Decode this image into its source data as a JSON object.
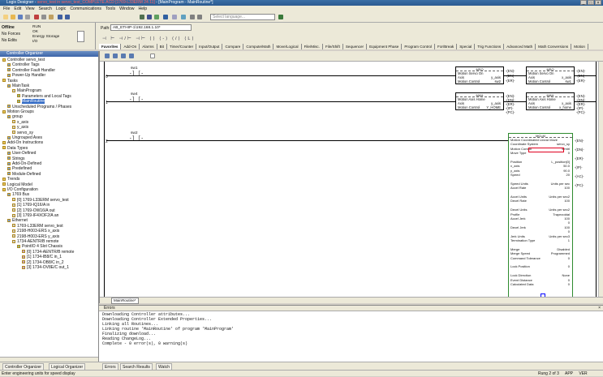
{
  "window": {
    "title_prefix": "Logix Designer - ",
    "title_red": "servo_test in servo_test_COMPLETE.ACD [1769-L33ERM 24.11]",
    "title_suffix": " - [MainProgram - MainRoutine*]"
  },
  "menu": [
    "File",
    "Edit",
    "View",
    "Search",
    "Logic",
    "Communications",
    "Tools",
    "Window",
    "Help"
  ],
  "toolbar": {
    "language_placeholder": "Select language..."
  },
  "controller_status": {
    "mode": "Offline",
    "forces": "No Forces",
    "edits": "No Edits",
    "run_label": "RUN",
    "ok_label": "OK",
    "energy_label": "Energy Storage",
    "io_label": "I/O",
    "path_label": "Path:",
    "path_value": "AB_ETHIP-1\\192.168.1.10*"
  },
  "instruction_tabs": [
    "Favorites",
    "Add-On",
    "Alarms",
    "Bit",
    "Timer/Counter",
    "Input/Output",
    "Compare",
    "Compute/Math",
    "Move/Logical",
    "File/Misc.",
    "File/Shift",
    "Sequencer",
    "Equipment Phase",
    "Program Control",
    "For/Break",
    "Special",
    "Trig Functions",
    "Advanced Math",
    "Math Conversions",
    "Motion"
  ],
  "organizer": {
    "title": "Controller Organizer",
    "tree": [
      {
        "label": "Controller servo_test",
        "indent": 0
      },
      {
        "label": "Controller Tags",
        "indent": 1
      },
      {
        "label": "Controller Fault Handler",
        "indent": 1
      },
      {
        "label": "Power-Up Handler",
        "indent": 1
      },
      {
        "label": "Tasks",
        "indent": 0
      },
      {
        "label": "MainTask",
        "indent": 1
      },
      {
        "label": "MainProgram",
        "indent": 2
      },
      {
        "label": "Parameters and Local Tags",
        "indent": 3
      },
      {
        "label": "MainRoutine",
        "indent": 3,
        "selected": true
      },
      {
        "label": "Unscheduled Programs / Phases",
        "indent": 1
      },
      {
        "label": "Motion Groups",
        "indent": 0
      },
      {
        "label": "group",
        "indent": 1
      },
      {
        "label": "x_axis",
        "indent": 2
      },
      {
        "label": "y_axis",
        "indent": 2
      },
      {
        "label": "servo_sy",
        "indent": 2
      },
      {
        "label": "Ungrouped Axes",
        "indent": 1
      },
      {
        "label": "Add-On Instructions",
        "indent": 0
      },
      {
        "label": "Data Types",
        "indent": 0
      },
      {
        "label": "User-Defined",
        "indent": 1
      },
      {
        "label": "Strings",
        "indent": 1
      },
      {
        "label": "Add-On-Defined",
        "indent": 1
      },
      {
        "label": "Predefined",
        "indent": 1
      },
      {
        "label": "Module-Defined",
        "indent": 1
      },
      {
        "label": "Trends",
        "indent": 0
      },
      {
        "label": "Logical Model",
        "indent": 0
      },
      {
        "label": "I/O Configuration",
        "indent": 0
      },
      {
        "label": "1769 Bus",
        "indent": 1
      },
      {
        "label": "[0] 1769-L33ERM servo_test",
        "indent": 2
      },
      {
        "label": "[1] 1769-IQ16/A in",
        "indent": 2
      },
      {
        "label": "[2] 1769-OW16/A out",
        "indent": 2
      },
      {
        "label": "[3] 1769-IF4XOF2/A an",
        "indent": 2
      },
      {
        "label": "Ethernet",
        "indent": 1
      },
      {
        "label": "1769-L33ERM servo_test",
        "indent": 2
      },
      {
        "label": "2198-H003-ERS x_axis",
        "indent": 2
      },
      {
        "label": "2198-H003-ERS y_axis",
        "indent": 2
      },
      {
        "label": "1734-AENTR/B remote",
        "indent": 2
      },
      {
        "label": "PointIO 4 Slot Chassis",
        "indent": 3
      },
      {
        "label": "[0] 1734-AENTR/B remote",
        "indent": 4
      },
      {
        "label": "[1] 1734-IB8/C in_1",
        "indent": 4
      },
      {
        "label": "[2] 1734-OB8/C in_2",
        "indent": 4
      },
      {
        "label": "[3] 1734-OV8E/C out_1",
        "indent": 4
      }
    ]
  },
  "ladder": {
    "rung0": {
      "num": "0",
      "tag": "sw1",
      "instr_title": "MSO",
      "instr_name": "Motion Servo On",
      "axis_label": "Axis",
      "axis": "y_axis",
      "mc_label": "Motion Control",
      "mc": "sw2",
      "instr2_title": "MSO",
      "instr2_name": "Motion Servo On",
      "axis2": "x_axis",
      "mc2": "sw1"
    },
    "rung1": {
      "num": "1",
      "tag": "sw4",
      "instr_title": "MAH",
      "instr_name": "Motion Axis Home",
      "axis": "y_axis",
      "mc": "Y_HOME",
      "instr2_title": "MAH",
      "instr2_name": "Motion Axis Home",
      "axis2": "x_axis",
      "mc2": "x_home"
    },
    "rung2": {
      "num": "2",
      "tag": "sw2"
    },
    "pins": {
      "en": "EN",
      "dn": "DN",
      "er": "ER",
      "ip": "IP",
      "pc": "PC",
      "ip2": "IP",
      "ac": "AC"
    },
    "mcln": {
      "title": "MCLM",
      "rows": [
        [
          "Motion Coordinated Linear Move",
          ""
        ],
        [
          "Coordinate System",
          "servo_sy"
        ],
        [
          "Motion Control",
          "xfmtrl"
        ],
        [
          "Move Type",
          "0"
        ],
        [
          "",
          ""
        ],
        [
          "Position",
          "L_position[0]"
        ],
        [
          "x_axis",
          "50.0"
        ],
        [
          "y_axis",
          "90.0"
        ],
        [
          "Speed",
          "20"
        ],
        [
          "",
          ""
        ],
        [
          "Speed Units",
          "Units per sec"
        ],
        [
          "Accel Rate",
          "100"
        ],
        [
          "",
          ""
        ],
        [
          "Accel Units",
          "Units per sec2"
        ],
        [
          "Decel Rate",
          "100"
        ],
        [
          "",
          ""
        ],
        [
          "Decel Units",
          "Units per sec2"
        ],
        [
          "Profile",
          "Trapezoidal"
        ],
        [
          "Accel Jerk",
          "100"
        ],
        [
          "",
          "0"
        ],
        [
          "Decel Jerk",
          "100"
        ],
        [
          "",
          "0"
        ],
        [
          "Jerk Units",
          "Units per sec3"
        ],
        [
          "Termination Type",
          "1"
        ],
        [
          "",
          ""
        ],
        [
          "Merge",
          "Disabled"
        ],
        [
          "Merge Speed",
          "Programmed"
        ],
        [
          "Command Tolerance",
          "0"
        ],
        [
          "",
          ""
        ],
        [
          "Lock Position",
          "0"
        ],
        [
          "",
          ""
        ],
        [
          "Lock Direction",
          "None"
        ],
        [
          "Event Distance",
          "0"
        ],
        [
          "Calculated Data",
          "0"
        ]
      ]
    }
  },
  "routine_tab": "MainRoutine*",
  "errors": {
    "title": "Errors",
    "lines": "Downloading Controller attributes...\nDownloading Controller Extended Properties...\nLinking all Routines...\nLinking routine 'MainRoutine' of program 'MainProgram'\nFinalizing download...\nReading ChangeLog...\nComplete - 0 error(s), 0 warning(s)"
  },
  "bottom_tabs": [
    "Controller Organizer",
    "Logical Organizer",
    "Errors",
    "Search Results",
    "Watch"
  ],
  "statusbar": {
    "hint": "Enter engineering units for speed display",
    "rung": "Rung 2 of 3",
    "app": "APP",
    "ver": "VER"
  }
}
